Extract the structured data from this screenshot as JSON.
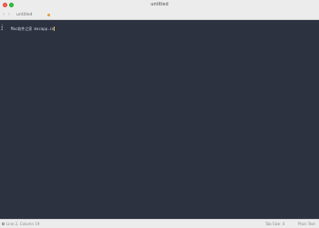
{
  "window": {
    "title": "untitled"
  },
  "tabs": [
    {
      "label": "untitled",
      "modified": true
    }
  ],
  "nav": {
    "back_glyph": "‹",
    "forward_glyph": "›"
  },
  "editor": {
    "lines": [
      {
        "number": "1",
        "text": ""
      },
      {
        "number": "2",
        "text": "Mac软件之家 macapp.cn"
      }
    ],
    "cursor_line": 2
  },
  "status": {
    "position": "Line 2, Column 19",
    "tab_size": "Tab Size: 4",
    "syntax": "Plain Text"
  },
  "colors": {
    "editor_background": "#2c3240",
    "chrome_background": "#ececec",
    "modified_dot": "#e59a3c",
    "cursor": "#e0b24a",
    "close_button": "#ff5f57",
    "maximize_button": "#28c840"
  },
  "icons": {
    "close": "close-icon",
    "maximize": "maximize-icon",
    "back": "chevron-left-icon",
    "forward": "chevron-right-icon",
    "status": "panel-icon"
  }
}
